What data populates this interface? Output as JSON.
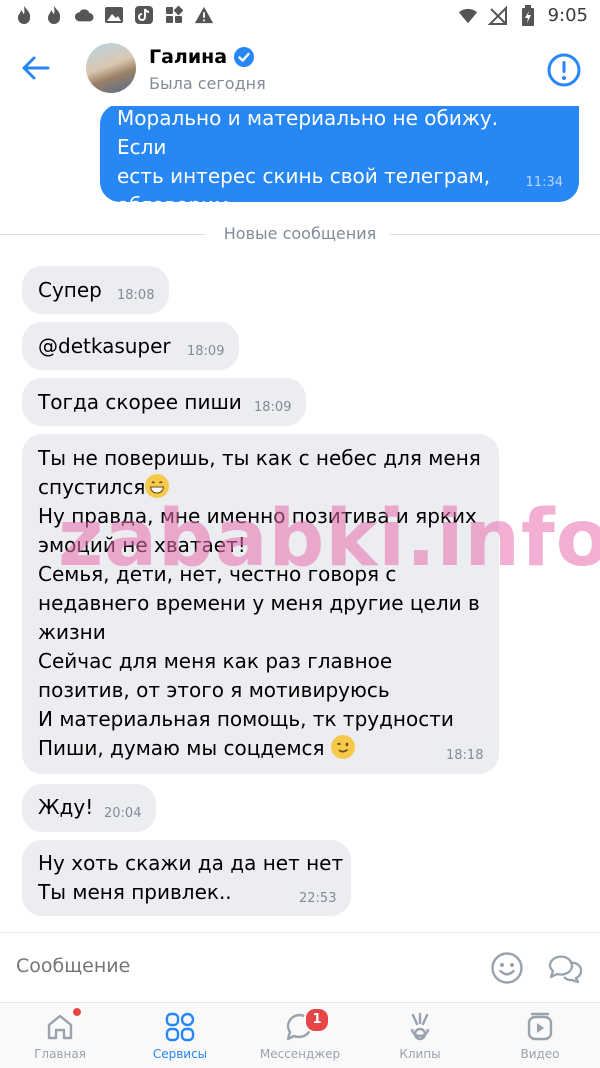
{
  "status_bar": {
    "time": "9:05"
  },
  "header": {
    "back_icon": "arrow-left-icon",
    "name": "Галина",
    "verified_icon": "verified-check-icon",
    "subtitle": "Была сегодня",
    "alert_icon": "exclamation-circle-icon",
    "accent": "#2787f5"
  },
  "outgoing_message": {
    "text": "Морально и материально не обижу. Если\nесть интерес скинь свой телеграм,\nобговорим",
    "time": "11:34"
  },
  "divider": {
    "label": "Новые сообщения"
  },
  "messages": [
    {
      "text": "Супер",
      "time": "18:08"
    },
    {
      "text": "@detkasuper",
      "time": "18:09"
    },
    {
      "text": "Тогда скорее пиши",
      "time": "18:09"
    },
    {
      "line1": "Ты не поверишь, ты как с небес для меня",
      "line2": "спустился",
      "emoji1": "grinning-face",
      "rest": "Ну правда, мне именно позитива и ярких\nэмоций не хватает!\nСемья, дети, нет, честно говоря с\nнедавнего времени у меня другие цели в\nжизни\nСейчас для меня как раз главное\nпозитив, от этого я мотивируюсь\nИ материальная помощь, тк трудности",
      "last": "Пиши, думаю мы соцдемся ",
      "emoji2": "winking-face",
      "time": "18:18"
    },
    {
      "text": "Жду!",
      "time": "20:04"
    },
    {
      "text": "Ну хоть скажи да да нет нет\nТы меня привлек..",
      "time": "22:53"
    }
  ],
  "watermark": "zababki.info",
  "composer": {
    "placeholder": "Сообщение",
    "emoji_icon": "smile-icon",
    "bubbles_icon": "chat-bubbles-icon"
  },
  "tabbar": {
    "tabs": [
      {
        "label": "Главная",
        "icon": "home-icon",
        "dot": true
      },
      {
        "label": "Сервисы",
        "icon": "services-grid-icon",
        "active": true
      },
      {
        "label": "Мессенджер",
        "icon": "messenger-icon",
        "badge": "1"
      },
      {
        "label": "Клипы",
        "icon": "clips-icon"
      },
      {
        "label": "Видео",
        "icon": "video-icon"
      }
    ]
  }
}
